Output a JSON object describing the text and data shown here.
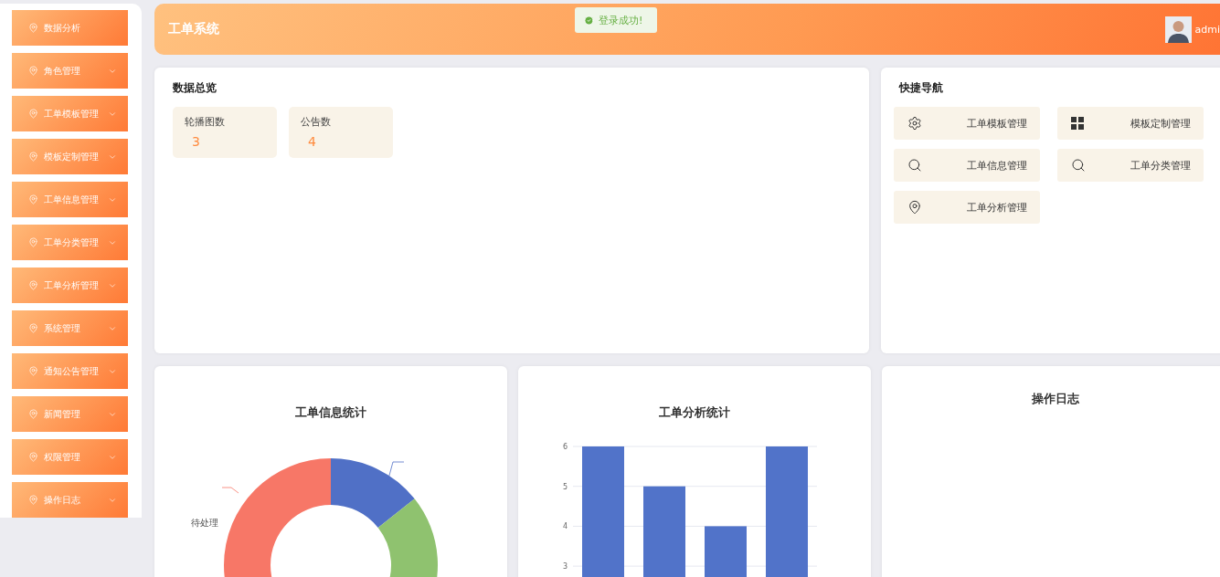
{
  "sidebar": {
    "items": [
      {
        "label": "数据分析",
        "expandable": false
      },
      {
        "label": "角色管理",
        "expandable": true
      },
      {
        "label": "工单模板管理",
        "expandable": true
      },
      {
        "label": "模板定制管理",
        "expandable": true
      },
      {
        "label": "工单信息管理",
        "expandable": true
      },
      {
        "label": "工单分类管理",
        "expandable": true
      },
      {
        "label": "工单分析管理",
        "expandable": true
      },
      {
        "label": "系统管理",
        "expandable": true
      },
      {
        "label": "通知公告管理",
        "expandable": true
      },
      {
        "label": "新闻管理",
        "expandable": true
      },
      {
        "label": "权限管理",
        "expandable": true
      },
      {
        "label": "操作日志",
        "expandable": true
      }
    ]
  },
  "header": {
    "title": "工单系统",
    "user": "admi"
  },
  "toast": {
    "message": "登录成功!"
  },
  "overview": {
    "title": "数据总览",
    "stats": [
      {
        "label": "轮播图数",
        "value": "3"
      },
      {
        "label": "公告数",
        "value": "4"
      }
    ]
  },
  "quick_nav": {
    "title": "快捷导航",
    "items": [
      {
        "label": "工单模板管理",
        "kind": "gear"
      },
      {
        "label": "模板定制管理",
        "kind": "grid"
      },
      {
        "label": "工单信息管理",
        "kind": "search"
      },
      {
        "label": "工单分类管理",
        "kind": "search"
      },
      {
        "label": "工单分析管理",
        "kind": "pin"
      }
    ]
  },
  "info_stats": {
    "title": "工单信息统计",
    "labels": [
      "待处理"
    ]
  },
  "analysis_stats": {
    "title": "工单分析统计",
    "chart_data": {
      "type": "bar",
      "values": [
        6,
        5,
        4,
        6
      ],
      "ylim": [
        0,
        6
      ],
      "grid": true,
      "yticks": [
        3,
        4,
        5,
        6
      ]
    }
  },
  "log": {
    "title": "操作日志"
  }
}
